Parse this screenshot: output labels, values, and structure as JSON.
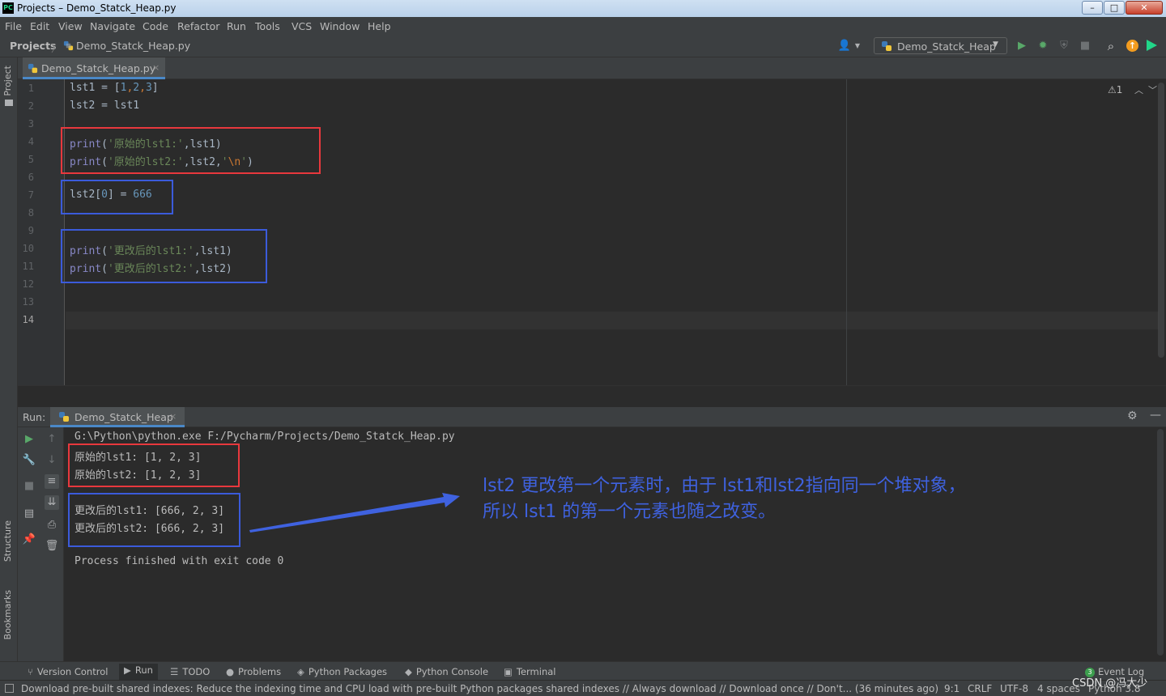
{
  "window": {
    "title": "Projects – Demo_Statck_Heap.py",
    "app_icon": "PC",
    "controls": {
      "minimize": "–",
      "maximize": "□",
      "close": "✕"
    }
  },
  "menu": [
    "File",
    "Edit",
    "View",
    "Navigate",
    "Code",
    "Refactor",
    "Run",
    "Tools",
    "VCS",
    "Window",
    "Help"
  ],
  "nav": {
    "root": "Projects",
    "separator": "〉",
    "file": "Demo_Statck_Heap.py",
    "run_config": "Demo_Statck_Heap"
  },
  "left_tabs": {
    "project": "Project",
    "structure": "Structure",
    "bookmarks": "Bookmarks"
  },
  "editor": {
    "tab_label": "Demo_Statck_Heap.py",
    "tab_close": "×",
    "warnings": "⚠1",
    "line_numbers": [
      "1",
      "2",
      "3",
      "4",
      "5",
      "6",
      "7",
      "8",
      "9",
      "10",
      "11",
      "12",
      "13",
      "14"
    ],
    "lines": {
      "l1": {
        "a": "lst1 = [",
        "b": "1",
        "c": ",",
        "d": "2",
        "e": ",",
        "f": "3",
        "g": "]"
      },
      "l2": "lst2 = lst1",
      "l4": {
        "fn": "print",
        "p1": "(",
        "s": "'原始的lst1:'",
        "p2": ",lst1)"
      },
      "l5": {
        "fn": "print",
        "p1": "(",
        "s": "'原始的lst2:'",
        "p2": ",lst2,",
        "s2a": "'",
        "esc": "\\n",
        "s2b": "'",
        "p3": ")"
      },
      "l7": {
        "a": "lst2[",
        "b": "0",
        "c": "] = ",
        "d": "666"
      },
      "l10": {
        "fn": "print",
        "p1": "(",
        "s": "'更改后的lst1:'",
        "p2": ",lst1)"
      },
      "l11": {
        "fn": "print",
        "p1": "(",
        "s": "'更改后的lst2:'",
        "p2": ",lst2)"
      }
    }
  },
  "run_panel": {
    "label": "Run:",
    "tab_label": "Demo_Statck_Heap",
    "tab_close": "×",
    "console": [
      "G:\\Python\\python.exe F:/Pycharm/Projects/Demo_Statck_Heap.py",
      "原始的lst1: [1, 2, 3]",
      "原始的lst2: [1, 2, 3]",
      "更改后的lst1: [666, 2, 3]",
      "更改后的lst2: [666, 2, 3]",
      "Process finished with exit code 0"
    ]
  },
  "annotation": {
    "line1": "lst2 更改第一个元素时，由于 lst1和lst2指向同一个堆对象，",
    "line2": "所以 lst1 的第一个元素也随之改变。",
    "color": "#3f62e0"
  },
  "bottom_tools": {
    "version_control": "Version Control",
    "run": "Run",
    "todo": "TODO",
    "problems": "Problems",
    "python_packages": "Python Packages",
    "python_console": "Python Console",
    "terminal": "Terminal",
    "event_count": "3",
    "event_log": "Event Log"
  },
  "status": {
    "message": "Download pre-built shared indexes: Reduce the indexing time and CPU load with pre-built Python packages shared indexes // Always download // Download once // Don't... (36 minutes ago)",
    "position": "9:1",
    "line_sep": "CRLF",
    "encoding": "UTF-8",
    "indent": "4 spaces",
    "interpreter": "Python 3.8"
  },
  "watermark": "CSDN @冯大少",
  "colors": {
    "accent": "#4a88c7",
    "red_box": "#e8383d",
    "blue_box": "#3b5bdb",
    "run_green": "#59a869"
  }
}
